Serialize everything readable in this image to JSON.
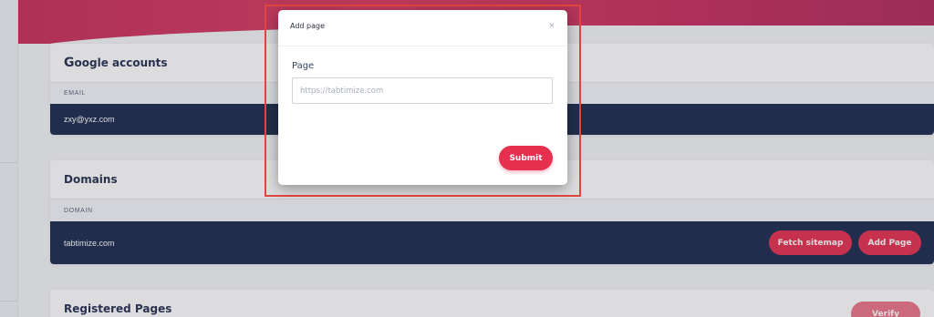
{
  "google_card": {
    "title_first": "G",
    "title_rest": "oogle accounts",
    "column": "EMAIL",
    "row_email": "zxy@yxz.com"
  },
  "domains_card": {
    "title": "Domains",
    "column": "DOMAIN",
    "row_domain": "tabtimize.com",
    "fetch_label": "Fetch sitemap",
    "add_label": "Add Page"
  },
  "registered_card": {
    "title": "Registered Pages",
    "verify_label": "Verify"
  },
  "modal": {
    "title": "Add page",
    "close": "×",
    "field_label": "Page",
    "field_placeholder": "https://tabtimize.com",
    "field_value": "",
    "submit_label": "Submit"
  },
  "colors": {
    "accent": "#e5304f",
    "dark_row": "#1c2a4d",
    "highlight": "#e2453d"
  }
}
